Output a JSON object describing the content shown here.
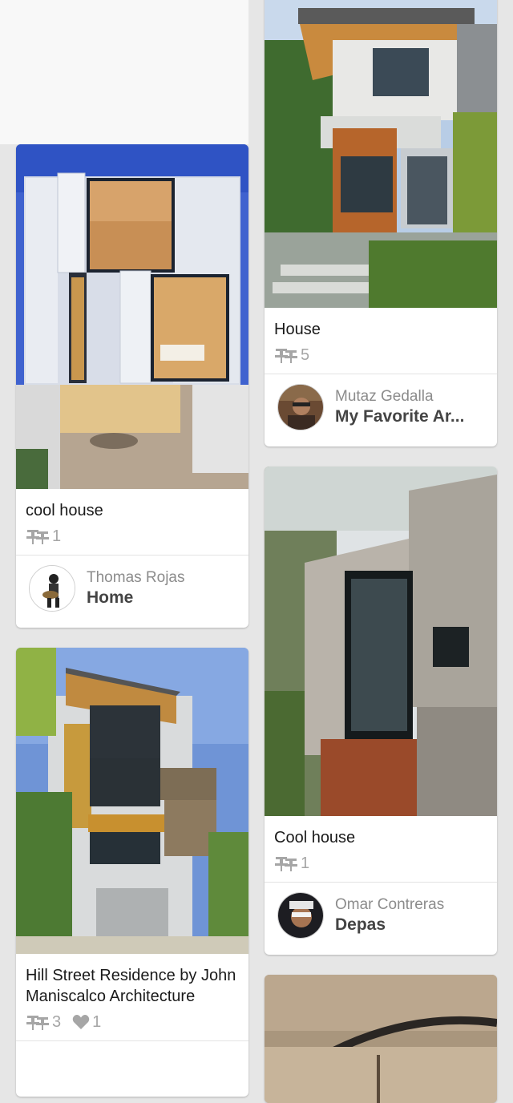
{
  "pins": [
    {
      "title": "cool house",
      "repins": "1",
      "likes": null,
      "pinner": "Thomas Rojas",
      "board": "Home"
    },
    {
      "title": "Hill Street Residence by John Maniscalco Architecture",
      "repins": "3",
      "likes": "1",
      "pinner": "",
      "board": ""
    },
    {
      "title": "House",
      "repins": "5",
      "likes": null,
      "pinner": "Mutaz Gedalla",
      "board": "My Favorite Ar..."
    },
    {
      "title": "Cool house",
      "repins": "1",
      "likes": null,
      "pinner": "Omar Contreras",
      "board": "Depas"
    }
  ],
  "icons": {
    "repin": "pushpin-icon",
    "like": "heart-icon"
  },
  "colors": {
    "background": "#e6e6e6",
    "card": "#ffffff",
    "stat_gray": "#a6a6a6"
  }
}
